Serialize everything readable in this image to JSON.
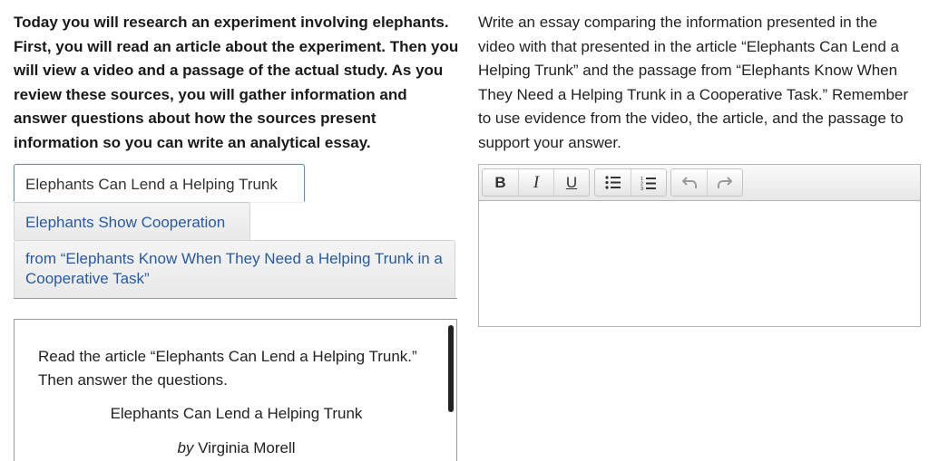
{
  "instructions": {
    "text": "Today you will research an experiment involving elephants. First, you will read an article about the experiment. Then you will view a video and a passage of the actual study. As you review these sources, you will gather information and answer questions about how the sources present information so you can write an analytical essay."
  },
  "tabs": [
    {
      "label": "Elephants Can Lend a Helping Trunk",
      "active": true
    },
    {
      "label": "Elephants Show Cooperation",
      "active": false
    },
    {
      "label": "from “Elephants Know When They Need a Helping Trunk in a Cooperative Task”",
      "active": false
    }
  ],
  "passage": {
    "intro": "Read the article “Elephants Can Lend a Helping Trunk.” Then answer the questions.",
    "title": "Elephants Can Lend a Helping Trunk",
    "byline_prefix": "by",
    "author": "Virginia Morell"
  },
  "prompt": {
    "text": "Write an essay comparing the information presented in the video with that presented in the article “Elephants Can Lend a Helping Trunk” and the passage from “Elephants Know When They Need a Helping Trunk in a Cooperative Task.” Remember to use evidence from the video, the article, and the passage to support your answer."
  },
  "editor": {
    "toolbar": {
      "bold": "B",
      "italic": "I",
      "underline": "U",
      "icons": [
        "bullet-list-icon",
        "numbered-list-icon",
        "undo-icon",
        "redo-icon"
      ]
    },
    "content": ""
  },
  "colors": {
    "tab_link": "#2a5a9a",
    "active_tab_border": "#5b8fd0"
  }
}
